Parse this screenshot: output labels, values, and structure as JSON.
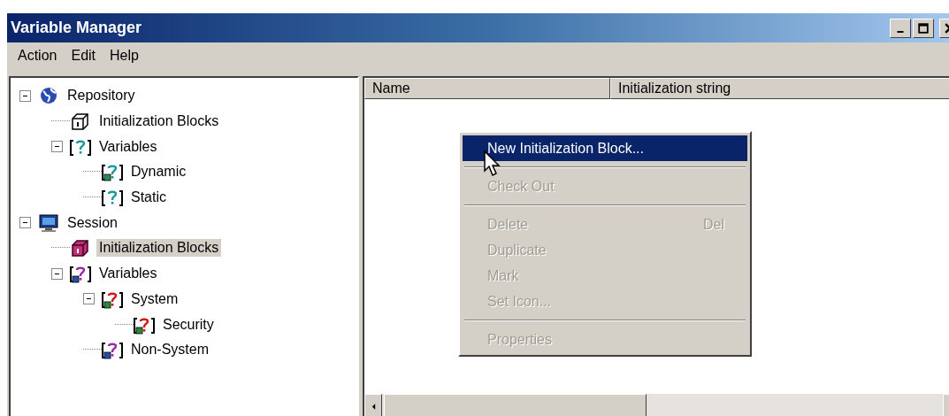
{
  "window": {
    "title": "Variable Manager"
  },
  "menu_bar": [
    "Action",
    "Edit",
    "Help"
  ],
  "tree": [
    {
      "label": "Repository",
      "kind": "globe",
      "expanded": true,
      "selected": false,
      "children": [
        {
          "label": "Initialization Blocks",
          "kind": "block",
          "selected": false
        },
        {
          "label": "Variables",
          "kind": "var-teal",
          "expanded": true,
          "selected": false,
          "children": [
            {
              "label": "Dynamic",
              "kind": "var-dynamic",
              "selected": false
            },
            {
              "label": "Static",
              "kind": "var-teal",
              "selected": false
            }
          ]
        }
      ]
    },
    {
      "label": "Session",
      "kind": "computer",
      "expanded": true,
      "selected": false,
      "children": [
        {
          "label": "Initialization Blocks",
          "kind": "block-magenta",
          "selected": true
        },
        {
          "label": "Variables",
          "kind": "var-purple",
          "expanded": true,
          "selected": false,
          "children": [
            {
              "label": "System",
              "kind": "var-red",
              "expanded": true,
              "selected": false,
              "children": [
                {
                  "label": "Security",
                  "kind": "var-red",
                  "selected": false
                }
              ]
            },
            {
              "label": "Non-System",
              "kind": "var-purple",
              "selected": false
            }
          ]
        }
      ]
    }
  ],
  "list": {
    "columns": [
      "Name",
      "Initialization string"
    ]
  },
  "context_menu": [
    {
      "kind": "item",
      "label": "New Initialization Block...",
      "disabled": false,
      "selected": true
    },
    {
      "kind": "separator"
    },
    {
      "kind": "item",
      "label": "Check Out",
      "disabled": true,
      "selected": false
    },
    {
      "kind": "separator"
    },
    {
      "kind": "item",
      "label": "Delete",
      "shortcut": "Del",
      "disabled": true,
      "selected": false
    },
    {
      "kind": "item",
      "label": "Duplicate",
      "disabled": true,
      "selected": false
    },
    {
      "kind": "item",
      "label": "Mark",
      "disabled": true,
      "selected": false
    },
    {
      "kind": "item",
      "label": "Set Icon...",
      "disabled": true,
      "selected": false
    },
    {
      "kind": "separator"
    },
    {
      "kind": "item",
      "label": "Properties",
      "disabled": true,
      "selected": false
    }
  ]
}
